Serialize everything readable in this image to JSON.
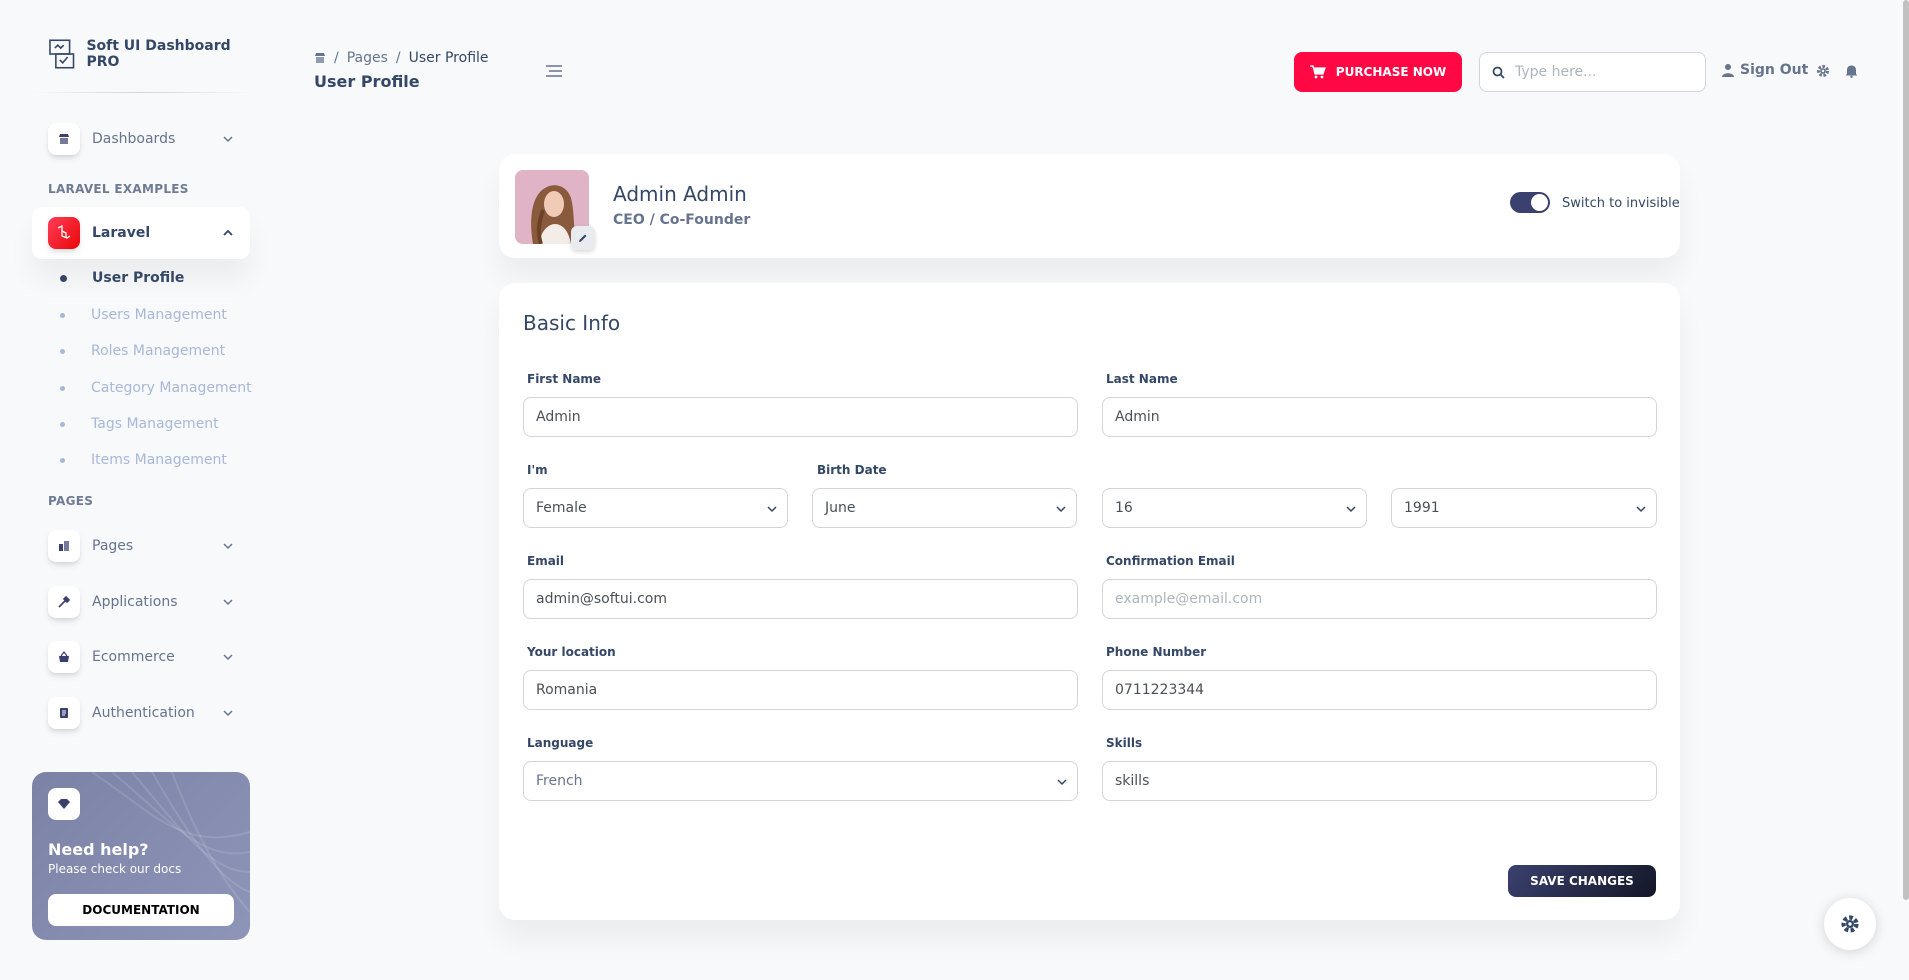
{
  "brand": {
    "name": "Soft UI Dashboard PRO"
  },
  "sidebar": {
    "items": [
      {
        "label": "Dashboards"
      },
      {
        "label": "Laravel"
      },
      {
        "label": "Pages"
      },
      {
        "label": "Applications"
      },
      {
        "label": "Ecommerce"
      },
      {
        "label": "Authentication"
      }
    ],
    "section_laravel": "LARAVEL EXAMPLES",
    "section_pages": "PAGES",
    "sub_items": [
      {
        "label": "User Profile"
      },
      {
        "label": "Users Management"
      },
      {
        "label": "Roles Management"
      },
      {
        "label": "Category Management"
      },
      {
        "label": "Tags Management"
      },
      {
        "label": "Items Management"
      }
    ],
    "help": {
      "title": "Need help?",
      "subtitle": "Please check our docs",
      "button": "DOCUMENTATION"
    }
  },
  "header": {
    "breadcrumb": [
      "Pages",
      "User Profile"
    ],
    "title": "User Profile",
    "purchase_label": "PURCHASE NOW",
    "search_placeholder": "Type here...",
    "signout_label": "Sign Out"
  },
  "profile": {
    "name": "Admin Admin",
    "role": "CEO / Co-Founder",
    "toggle_label": "Switch to invisible",
    "toggle_on": true
  },
  "form": {
    "title": "Basic Info",
    "first_name": {
      "label": "First Name",
      "value": "Admin"
    },
    "last_name": {
      "label": "Last Name",
      "value": "Admin"
    },
    "gender": {
      "label": "I'm",
      "value": "Female"
    },
    "birth": {
      "label": "Birth Date",
      "month": "June",
      "day": "16",
      "year": "1991"
    },
    "email": {
      "label": "Email",
      "value": "admin@softui.com"
    },
    "confirm_email": {
      "label": "Confirmation Email",
      "placeholder": "example@email.com"
    },
    "location": {
      "label": "Your location",
      "value": "Romania"
    },
    "phone": {
      "label": "Phone Number",
      "value": "0711223344"
    },
    "language": {
      "label": "Language",
      "value": "French"
    },
    "skills": {
      "label": "Skills",
      "value": "skills"
    },
    "save_label": "SAVE CHANGES"
  },
  "colors": {
    "accent": "#ff0844",
    "dark": "#344767",
    "toggle": "#3a416f"
  }
}
